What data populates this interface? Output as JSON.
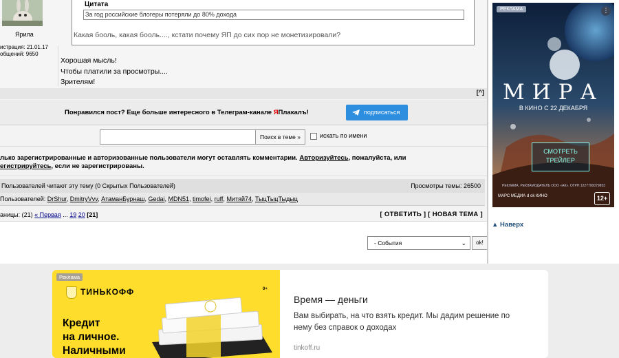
{
  "post": {
    "username": "Ярила",
    "registration": "истрация: 21.01.17",
    "posts_count": "общений: 9650",
    "quote_title": "Цитата",
    "quote_inner": "За год российские блогеры потеряли до 80% дохода",
    "quote_text": "Какая бооль, какая бооль...., кстати почему ЯП до сих пор не монетизировали?",
    "body_lines": [
      "Хорошая мысль!",
      "Чтобы платили за просмотры....",
      "Зрителям!"
    ],
    "up_link": "[^]"
  },
  "telegram": {
    "text_before": "Понравился пост? Еще больше интересного в Телеграм-канале ",
    "text_ya": "Я",
    "text_after": "Плакалъ!",
    "button_label": "подписаться"
  },
  "search": {
    "input_value": "",
    "button_label": "Поиск в теме »",
    "checkbox_label": "искать по имени"
  },
  "registration_notice": {
    "line1_prefix": "лько зарегистрированные и авторизованные пользователи могут оставлять комментарии. ",
    "line1_link": "Авторизуйтесь",
    "line1_suffix": ", пожалуйста, или",
    "line2_link": "егистрируйтесь",
    "line2_suffix": ", если не зарегистрированы."
  },
  "readers": {
    "header_left": "Пользователей читают эту тему (0 Скрытых Пользователей)",
    "header_right": "Просмотры темы: 26500",
    "list_prefix": "Пользователей: ",
    "users": [
      "DrShur",
      "DmitryVvv",
      "АтаманБурнаш",
      "Gedai",
      "MDN51",
      "timofei",
      "ruff",
      "Митяй74",
      "ТыцТыцТыдыц"
    ]
  },
  "pages": {
    "prefix": "аницы: (21) ",
    "first": "« Первая",
    "ellipsis": " ... ",
    "p19": "19",
    "p20": "20",
    "current": "[21]",
    "actions": "[ ОТВЕТИТЬ ] [ НОВАЯ ТЕМА ]"
  },
  "events": {
    "selected": "- События",
    "ok_label": "ok!"
  },
  "right_ad": {
    "badge": "РЕКЛАМА",
    "menu_glyph": "⋮",
    "title": "МИРА",
    "date": "В КИНО С 22 ДЕКАБРЯ",
    "watch_line1": "СМОТРЕТЬ",
    "watch_line2": "ТРЕЙЛЕР",
    "fine_print": "РЕКЛАМА. РЕКЛАМОДАТЕЛЬ ООО «АК». ОГРН 1227700079853",
    "logos": "МАРС МЕДИА   d   ok   КИНО",
    "age": "12+",
    "to_top": "Наверх"
  },
  "bottom_ad": {
    "badge": "Реклама",
    "brand": "ТИНЬКОФФ",
    "age": "0+",
    "headline": [
      "Кредит",
      "на личное.",
      "Наличными"
    ],
    "title": "Время — деньги",
    "description": "Вам выбирать, на что взять кредит. Мы дадим решение по нему без справок о доходах",
    "domain": "tinkoff.ru"
  },
  "colors": {
    "telegram_button": "#2d8ee0",
    "brand_yellow": "#ffdd2d",
    "link_blue": "#00008b"
  }
}
